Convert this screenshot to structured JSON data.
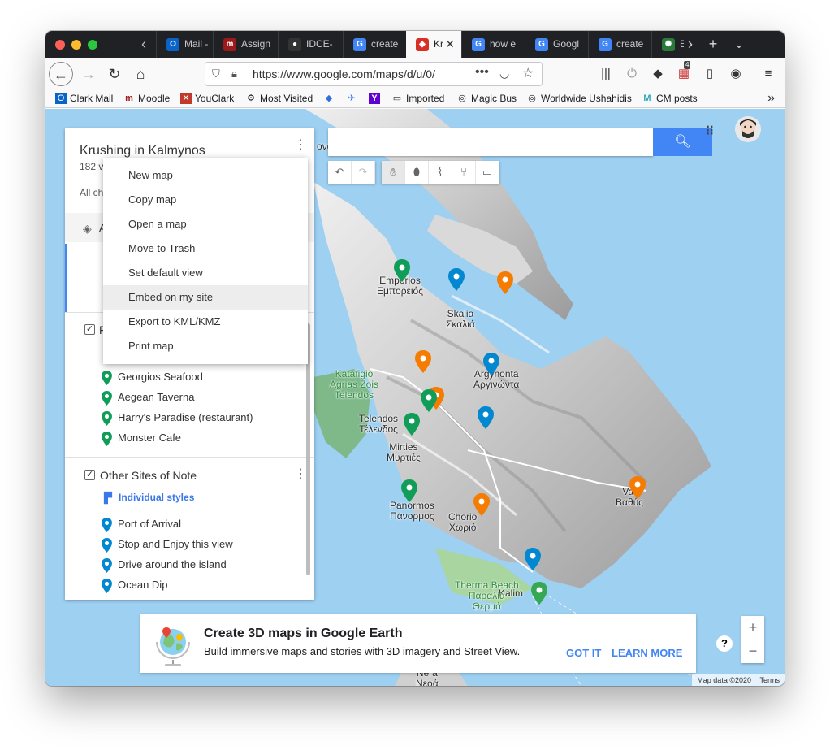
{
  "browser": {
    "tabs": [
      {
        "label": "Mail -",
        "fav": "O",
        "color": "#0a64c8"
      },
      {
        "label": "Assign",
        "fav": "m",
        "color": "#9b1b1b"
      },
      {
        "label": "IDCE-",
        "fav": "●",
        "color": "#333333"
      },
      {
        "label": "create",
        "fav": "G",
        "color": "#4285f4"
      },
      {
        "label": "Kr",
        "fav": "◆",
        "color": "#d93025"
      },
      {
        "label": "how e",
        "fav": "G",
        "color": "#4285f4"
      },
      {
        "label": "Googl",
        "fav": "G",
        "color": "#4285f4"
      },
      {
        "label": "create",
        "fav": "G",
        "color": "#4285f4"
      },
      {
        "label": "E",
        "fav": "✺",
        "color": "#2a7a3a"
      }
    ],
    "url": "https://www.google.com/maps/d/u/0/",
    "bookmarks": [
      "Clark Mail",
      "Moodle",
      "YouClark",
      "Most Visited",
      "",
      "",
      "",
      "Imported",
      "Magic Bus",
      "Worldwide Ushahidis",
      "CM posts"
    ],
    "badge_count": "4"
  },
  "panel": {
    "title": "Krushing in Kalmynos",
    "views": "182 v",
    "all_changes": "All ch",
    "base_layer_label": "A",
    "food_layer_initial": "F",
    "food_items": [
      "Georgios Seafood",
      "Aegean Taverna",
      "Harry's Paradise (restaurant)",
      "Monster Cafe"
    ],
    "sites_layer": "Other Sites of Note",
    "styles_label": "Individual styles",
    "sites_items": [
      "Port of Arrival",
      "Stop and Enjoy this view",
      "Drive around the island",
      "Ocean Dip"
    ]
  },
  "menu": {
    "items": [
      "New map",
      "Copy map",
      "Open a map",
      "Move to Trash",
      "Set default view",
      "Embed on my site",
      "Export to KML/KMZ",
      "Print map"
    ],
    "highlighted": "Embed on my site"
  },
  "map": {
    "search_placeholder": "",
    "places": {
      "emporios": [
        "Emporios",
        "Εμπορειός"
      ],
      "skalia": [
        "Skalia",
        "Σκαλιά"
      ],
      "argynonta": [
        "Argynonta",
        "Αργινώντα"
      ],
      "katafigio": [
        "Katafigio",
        "Agrias Zois",
        "Telendos"
      ],
      "telendos": [
        "Telendos",
        "Τέλενδος"
      ],
      "mirties": [
        "Mirties",
        "Μυρτιές"
      ],
      "panormos": [
        "Panormos",
        "Πάνορμος"
      ],
      "chorio": [
        "Chorio",
        "Χωριό"
      ],
      "vathys": [
        "Vat",
        "Βαθύς"
      ],
      "kalimnos": [
        "Kalim"
      ],
      "therma": [
        "Therma Beach",
        "Παραλία",
        "Θερμά"
      ],
      "nera": [
        "Nera",
        "Νεοά"
      ],
      "top_fragment": "ονα"
    },
    "attribution": "Map data ©2020",
    "terms": "Terms",
    "colors": {
      "green": "#0f9d58",
      "blue": "#0288d1",
      "orange": "#f57c00"
    }
  },
  "banner": {
    "title": "Create 3D maps in Google Earth",
    "subtitle": "Build immersive maps and stories with 3D imagery and Street View.",
    "got_it": "GOT IT",
    "learn_more": "LEARN MORE"
  }
}
